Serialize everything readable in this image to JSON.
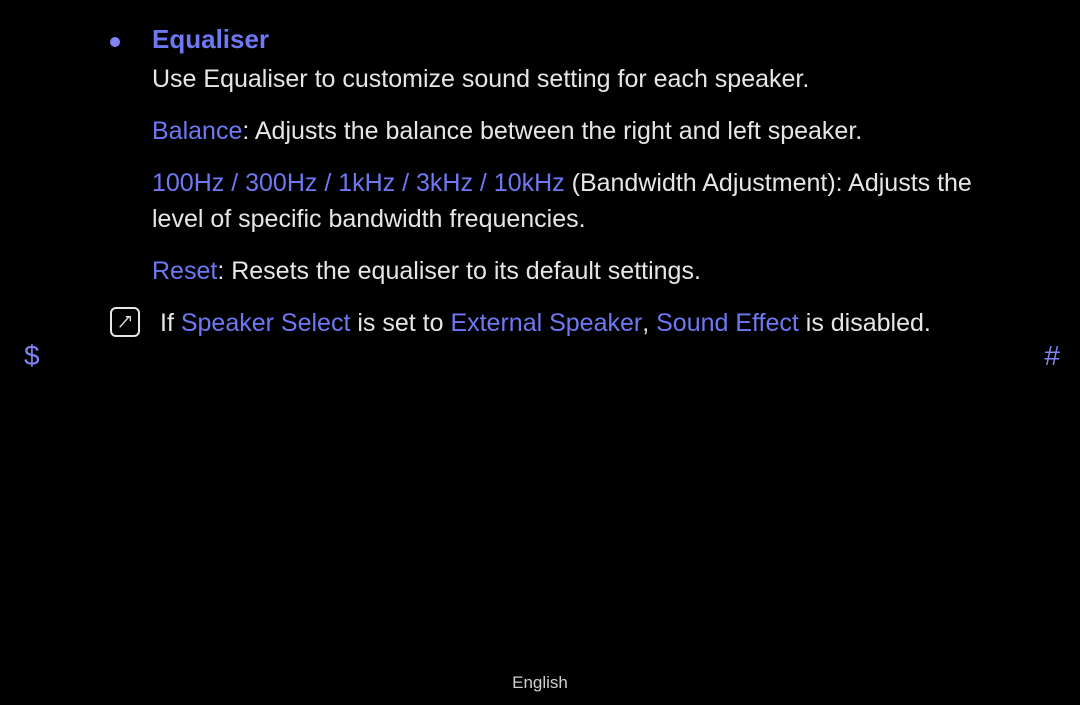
{
  "heading": "Equaliser",
  "intro": "Use Equaliser to customize sound setting for each speaker.",
  "balance": {
    "label": "Balance",
    "text": ": Adjusts the balance between the right and left speaker."
  },
  "bandwidth": {
    "label": "100Hz / 300Hz / 1kHz / 3kHz / 10kHz",
    "text_a": " (Bandwidth Adjustment): Adjusts the level of specific bandwidth frequencies."
  },
  "reset": {
    "label": "Reset",
    "text": ": Resets the equaliser to its default settings."
  },
  "note": {
    "if": "If ",
    "t1": "Speaker Select",
    "mid1": " is set to ",
    "t2": "External Speaker",
    "comma": ", ",
    "t3": "Sound Effect",
    "end": " is disabled."
  },
  "nav": {
    "left": "$",
    "right": "#"
  },
  "footer": "English"
}
